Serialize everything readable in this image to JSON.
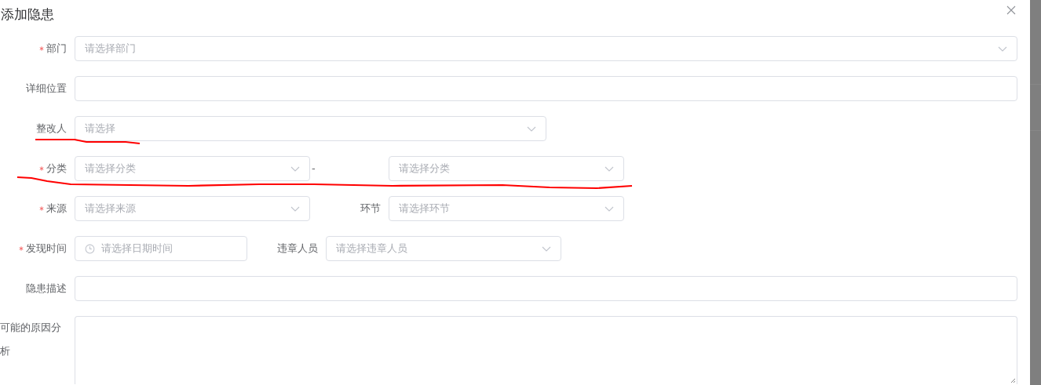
{
  "dialog": {
    "title": "添加隐患"
  },
  "rows": [
    {
      "kind": "wide",
      "items": [
        {
          "label": "部门",
          "required": true,
          "kind": "select",
          "placeholder": "请选择部门"
        }
      ]
    },
    {
      "kind": "wide",
      "items": [
        {
          "label": "详细位置",
          "required": false,
          "kind": "input"
        }
      ]
    },
    {
      "kind": "half",
      "items": [
        {
          "label": "整改人",
          "required": false,
          "kind": "select",
          "placeholder": "请选择"
        }
      ]
    },
    {
      "kind": "range",
      "separator": "-",
      "items": [
        {
          "label": "分类",
          "required": true,
          "kind": "select",
          "placeholder": "请选择分类"
        },
        {
          "kind": "select",
          "placeholder": "请选择分类"
        }
      ]
    },
    {
      "kind": "pair",
      "items": [
        {
          "label": "来源",
          "required": true,
          "kind": "select",
          "placeholder": "请选择来源"
        },
        {
          "label": "环节",
          "required": false,
          "kind": "select",
          "placeholder": "请选择环节"
        }
      ]
    },
    {
      "kind": "pair",
      "items": [
        {
          "label": "发现时间",
          "required": true,
          "kind": "date",
          "placeholder": "请选择日期时间"
        },
        {
          "label": "违章人员",
          "required": false,
          "kind": "select",
          "placeholder": "请选择违章人员"
        }
      ]
    },
    {
      "kind": "wide",
      "items": [
        {
          "label": "隐患描述",
          "required": false,
          "kind": "input"
        }
      ]
    },
    {
      "kind": "wide",
      "items": [
        {
          "label": "可能的原因分析",
          "required": false,
          "kind": "textarea"
        }
      ]
    }
  ]
}
